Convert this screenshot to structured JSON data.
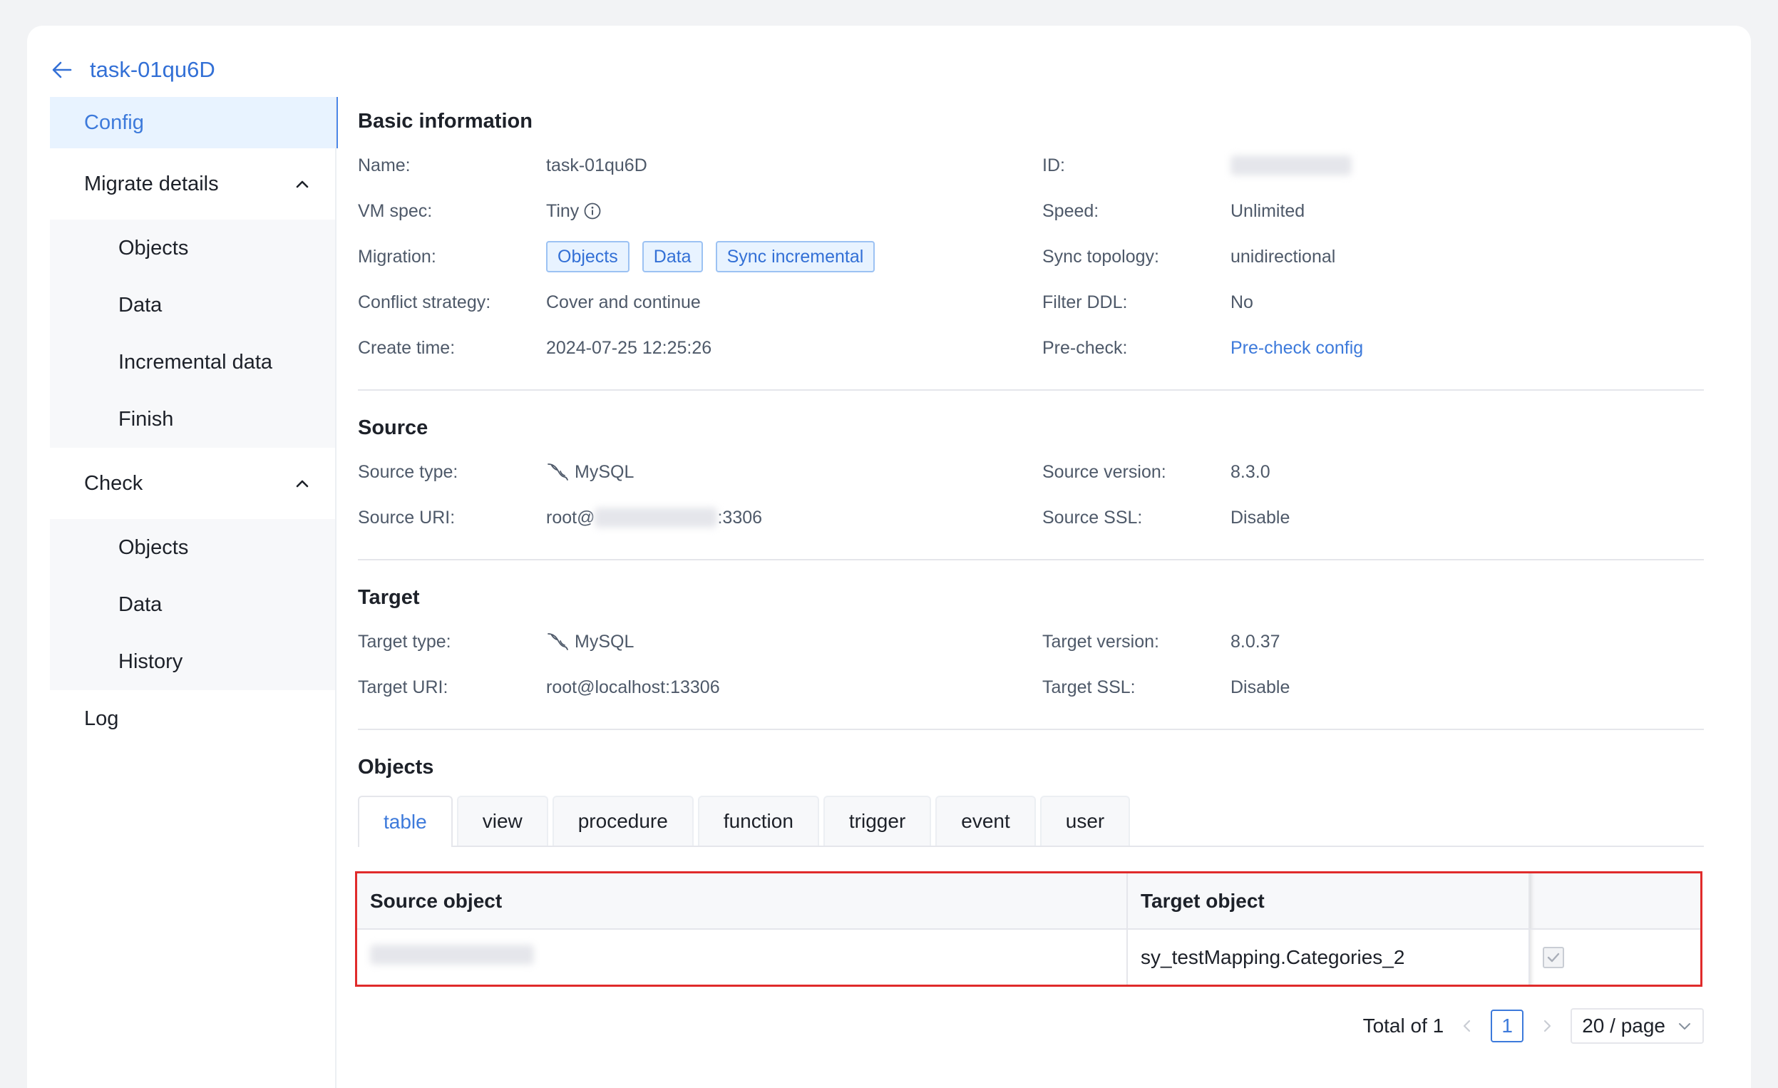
{
  "header": {
    "title": "task-01qu6D"
  },
  "sidebar": {
    "items": [
      {
        "label": "Config"
      },
      {
        "label": "Migrate details",
        "children": [
          "Objects",
          "Data",
          "Incremental data",
          "Finish"
        ]
      },
      {
        "label": "Check",
        "children": [
          "Objects",
          "Data",
          "History"
        ]
      },
      {
        "label": "Log"
      }
    ]
  },
  "basic": {
    "title": "Basic information",
    "name_label": "Name:",
    "name_value": "task-01qu6D",
    "id_label": "ID:",
    "vm_label": "VM spec:",
    "vm_value": "Tiny",
    "speed_label": "Speed:",
    "speed_value": "Unlimited",
    "migration_label": "Migration:",
    "migration_tags": [
      "Objects",
      "Data",
      "Sync incremental"
    ],
    "topology_label": "Sync topology:",
    "topology_value": "unidirectional",
    "conflict_label": "Conflict strategy:",
    "conflict_value": "Cover and continue",
    "ddl_label": "Filter DDL:",
    "ddl_value": "No",
    "create_label": "Create time:",
    "create_value": "2024-07-25 12:25:26",
    "precheck_label": "Pre-check:",
    "precheck_value": "Pre-check config"
  },
  "source": {
    "title": "Source",
    "type_label": "Source type:",
    "type_value": "MySQL",
    "version_label": "Source version:",
    "version_value": "8.3.0",
    "uri_label": "Source URI:",
    "uri_prefix": "root@",
    "uri_suffix": ":3306",
    "ssl_label": "Source SSL:",
    "ssl_value": "Disable"
  },
  "target": {
    "title": "Target",
    "type_label": "Target type:",
    "type_value": "MySQL",
    "version_label": "Target version:",
    "version_value": "8.0.37",
    "uri_label": "Target URI:",
    "uri_value": "root@localhost:13306",
    "ssl_label": "Target SSL:",
    "ssl_value": "Disable"
  },
  "objects": {
    "title": "Objects",
    "tabs": [
      "table",
      "view",
      "procedure",
      "function",
      "trigger",
      "event",
      "user"
    ],
    "columns": {
      "source": "Source object",
      "target": "Target object"
    },
    "rows": [
      {
        "target": "sy_testMapping.Categories_2"
      }
    ]
  },
  "pagination": {
    "total": "Total of 1",
    "page": "1",
    "page_size": "20 / page"
  },
  "colors": {
    "accent": "#3d7adb",
    "highlight": "#e02b2b"
  }
}
